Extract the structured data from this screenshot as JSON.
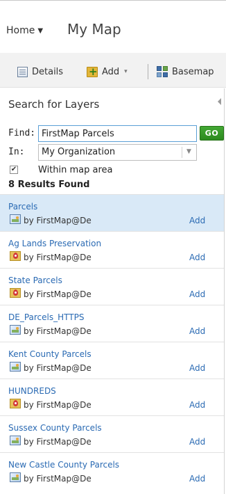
{
  "header": {
    "home_label": "Home",
    "home_caret": "▼",
    "map_title": "My Map"
  },
  "toolbar": {
    "details_label": "Details",
    "add_label": "Add",
    "add_caret": "▾",
    "basemap_label": "Basemap",
    "icons": [
      "details-icon",
      "add-layer-icon",
      "basemap-icon"
    ]
  },
  "search": {
    "title": "Search for Layers",
    "find_label": "Find:",
    "find_value": "FirstMap Parcels",
    "go_label": "GO",
    "in_label": "In:",
    "in_value": "My Organization",
    "in_caret": "▼",
    "within_label": "Within map area",
    "within_checked": true,
    "within_check_mark": "✔",
    "results_count": "8 Results Found"
  },
  "results": [
    {
      "title": "Parcels",
      "author": "by FirstMap@De",
      "add": "Add",
      "icon": "map-layer-icon",
      "selected": true
    },
    {
      "title": "Ag Lands Preservation",
      "author": "by FirstMap@De",
      "add": "Add",
      "icon": "map-marker-icon",
      "selected": false
    },
    {
      "title": "State Parcels",
      "author": "by FirstMap@De",
      "add": "Add",
      "icon": "map-marker-icon",
      "selected": false
    },
    {
      "title": "DE_Parcels_HTTPS",
      "author": "by FirstMap@De",
      "add": "Add",
      "icon": "map-layer-icon",
      "selected": false
    },
    {
      "title": "Kent County Parcels",
      "author": "by FirstMap@De",
      "add": "Add",
      "icon": "map-layer-icon",
      "selected": false
    },
    {
      "title": "HUNDREDS",
      "author": "by FirstMap@De",
      "add": "Add",
      "icon": "map-marker-icon",
      "selected": false
    },
    {
      "title": "Sussex County Parcels",
      "author": "by FirstMap@De",
      "add": "Add",
      "icon": "map-layer-icon",
      "selected": false
    },
    {
      "title": "New Castle County Parcels",
      "author": "by FirstMap@De",
      "add": "Add",
      "icon": "map-layer-icon",
      "selected": false
    }
  ],
  "colors": {
    "accent_link": "#2a6ab3",
    "go_button": "#2c8a1e",
    "selected_row": "#d9e9f7",
    "toolbar_bg": "#f2f2f2"
  }
}
